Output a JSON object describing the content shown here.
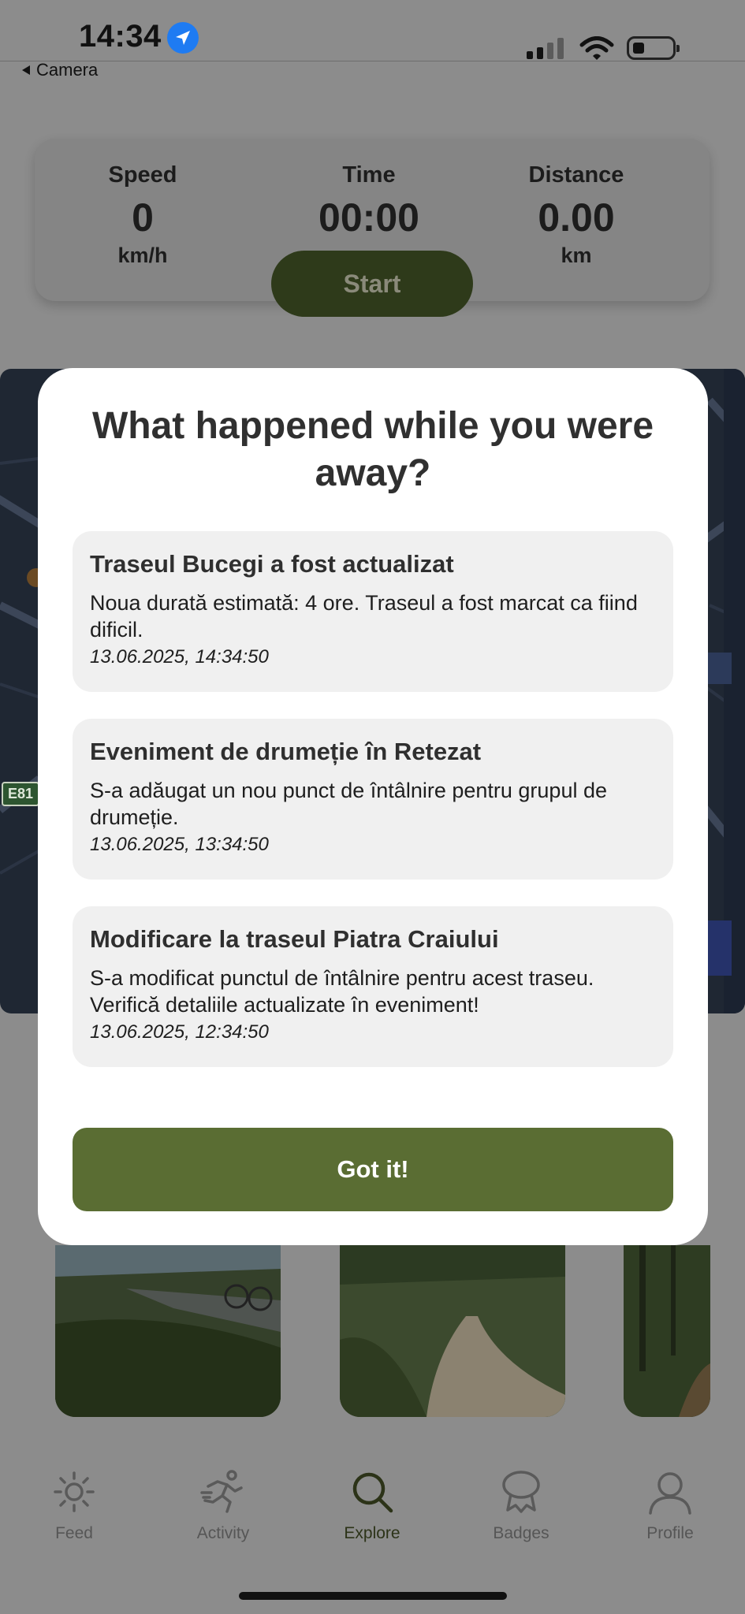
{
  "status_bar": {
    "time": "14:34",
    "back_label": "Camera"
  },
  "tracker": {
    "speed": {
      "label": "Speed",
      "value": "0",
      "unit": "km/h"
    },
    "time": {
      "label": "Time",
      "value": "00:00"
    },
    "distance": {
      "label": "Distance",
      "value": "0.00",
      "unit": "km"
    },
    "start_label": "Start"
  },
  "map": {
    "road_shield": "E81"
  },
  "modal": {
    "title": "What happened while you were away?",
    "notifications": [
      {
        "title": "Traseul Bucegi a fost actualizat",
        "body": "Noua durată estimată: 4 ore. Traseul a fost marcat ca fiind dificil.",
        "date": "13.06.2025, 14:34:50"
      },
      {
        "title": "Eveniment de drumeție în Retezat",
        "body": "S-a adăugat un nou punct de întâlnire pentru grupul de drumeție.",
        "date": "13.06.2025, 13:34:50"
      },
      {
        "title": "Modificare la traseul Piatra Craiului",
        "body": "S-a modificat punctul de întâlnire pentru acest traseu. Verifică detaliile actualizate în eveniment!",
        "date": "13.06.2025, 12:34:50"
      }
    ],
    "confirm_label": "Got it!"
  },
  "tab_bar": {
    "items": [
      {
        "label": "Feed",
        "icon": "sun-icon"
      },
      {
        "label": "Activity",
        "icon": "runner-icon"
      },
      {
        "label": "Explore",
        "icon": "search-icon",
        "active": true
      },
      {
        "label": "Badges",
        "icon": "badge-icon"
      },
      {
        "label": "Profile",
        "icon": "person-icon"
      }
    ]
  },
  "colors": {
    "accent": "#5a6d33",
    "overlay": "#8c8c8c",
    "card": "#f0f0f0"
  }
}
